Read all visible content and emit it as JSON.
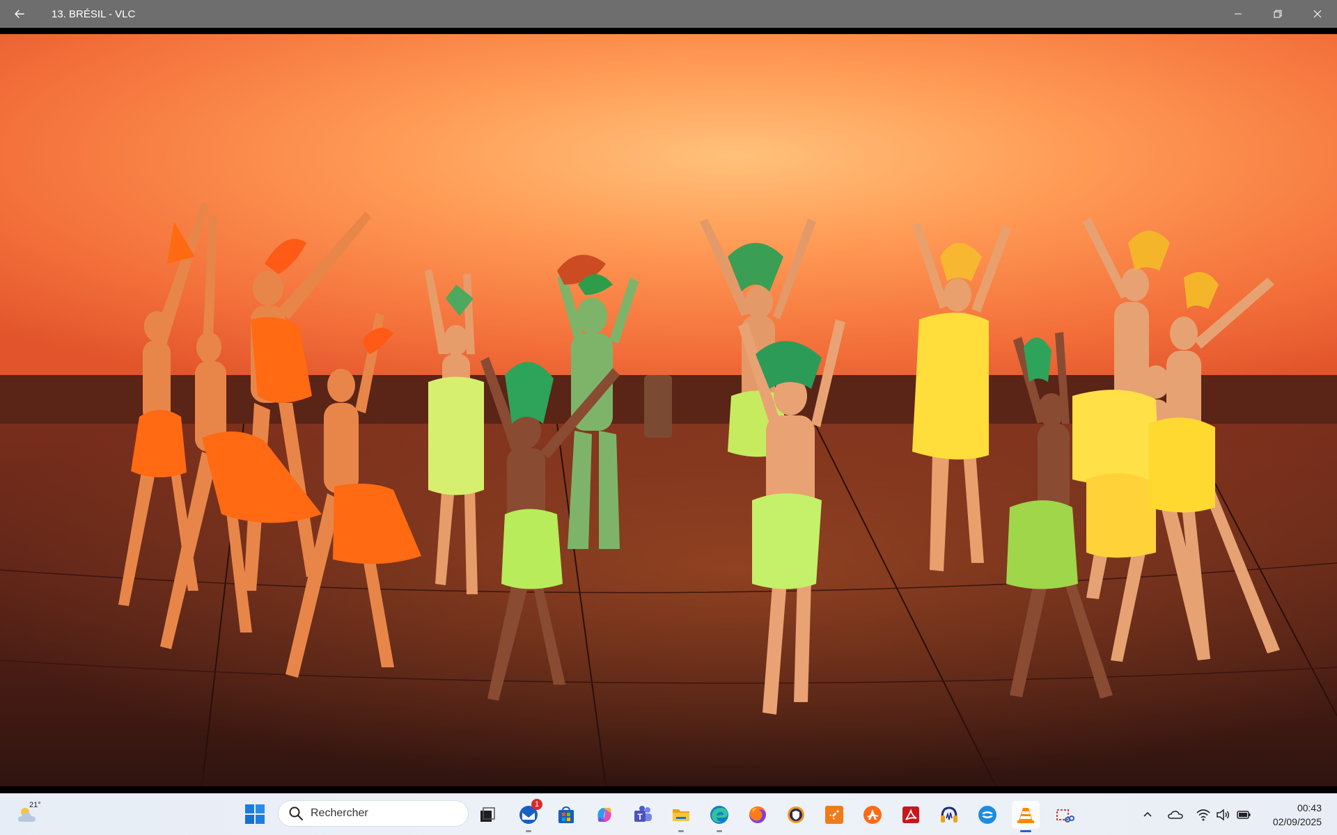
{
  "window": {
    "title": "13. BRÉSIL - VLC",
    "back_icon": "arrow-left-icon",
    "controls": [
      "minimize-icon",
      "restore-icon",
      "close-icon"
    ]
  },
  "video": {
    "content": "video-frame"
  },
  "taskbar": {
    "weather_temp": "21°",
    "weather_icon": "cloud-icon",
    "search_placeholder": "Rechercher",
    "apps": [
      {
        "name": "task-view",
        "icon": "task-view-icon"
      },
      {
        "name": "thunderbird",
        "icon": "thunderbird-icon",
        "badge": "1"
      },
      {
        "name": "microsoft-store",
        "icon": "store-icon"
      },
      {
        "name": "copilot",
        "icon": "copilot-icon"
      },
      {
        "name": "teams",
        "icon": "teams-icon"
      },
      {
        "name": "file-explorer",
        "icon": "folder-icon"
      },
      {
        "name": "edge",
        "icon": "edge-icon"
      },
      {
        "name": "firefox",
        "icon": "firefox-icon"
      },
      {
        "name": "bitwarden",
        "icon": "shield-icon"
      },
      {
        "name": "app-orange",
        "icon": "rocket-icon"
      },
      {
        "name": "avast",
        "icon": "avast-icon"
      },
      {
        "name": "acrobat",
        "icon": "pdf-icon"
      },
      {
        "name": "audacity",
        "icon": "headphones-icon"
      },
      {
        "name": "app-blue",
        "icon": "sync-icon"
      },
      {
        "name": "vlc",
        "icon": "vlc-cone-icon"
      },
      {
        "name": "snipping-tool",
        "icon": "snip-icon"
      }
    ],
    "tray": [
      "chevron-up-icon",
      "onedrive-icon",
      "wifi-icon",
      "volume-icon",
      "battery-icon"
    ],
    "clock": {
      "time": "00:43",
      "date": "02/09/2025"
    },
    "colors": {
      "accent": "#1d63d8",
      "badge": "#d52b2b"
    }
  }
}
